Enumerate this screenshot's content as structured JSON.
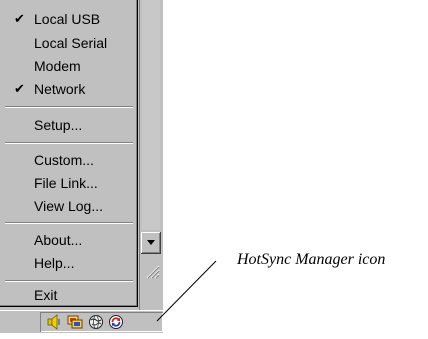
{
  "menu": {
    "items": [
      {
        "label": "Local USB",
        "checked": true
      },
      {
        "label": "Local Serial",
        "checked": false
      },
      {
        "label": "Modem",
        "checked": false
      },
      {
        "label": "Network",
        "checked": true
      },
      {
        "label": "Setup..."
      },
      {
        "label": "Custom..."
      },
      {
        "label": "File Link..."
      },
      {
        "label": "View Log..."
      },
      {
        "label": "About..."
      },
      {
        "label": "Help..."
      },
      {
        "label": "Exit"
      }
    ],
    "check_glyph": "✔"
  },
  "tray": {
    "icons": [
      "speaker-icon",
      "network-monitor-icon",
      "globe-icon",
      "hotsync-icon"
    ]
  },
  "callout": {
    "text": "HotSync Manager icon"
  }
}
